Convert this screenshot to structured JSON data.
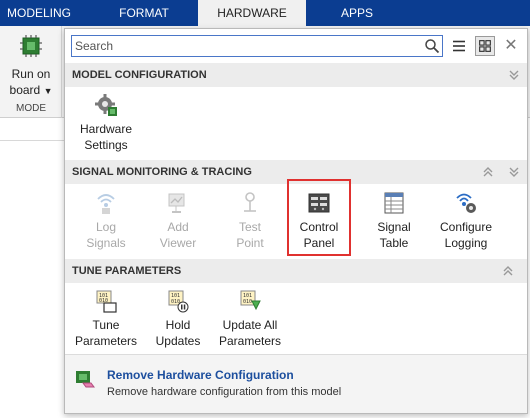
{
  "tabs": [
    {
      "label": "MODELING",
      "active": false
    },
    {
      "label": "FORMAT",
      "active": false
    },
    {
      "label": "HARDWARE",
      "active": true
    },
    {
      "label": "APPS",
      "active": false
    }
  ],
  "ribbon": {
    "mode_button": {
      "line1": "Run on",
      "line2": "board",
      "icon": "chip-icon"
    },
    "mode_caption": "MODE"
  },
  "search": {
    "placeholder": "Search",
    "value": ""
  },
  "sections": {
    "model_configuration": {
      "title": "MODEL CONFIGURATION",
      "items": [
        {
          "line1": "Hardware",
          "line2": "Settings",
          "icon": "hardware-settings-gear-icon",
          "enabled": true
        }
      ]
    },
    "signal_monitoring": {
      "title": "SIGNAL MONITORING & TRACING",
      "items": [
        {
          "line1": "Log",
          "line2": "Signals",
          "icon": "log-signals-icon",
          "enabled": false
        },
        {
          "line1": "Add",
          "line2": "Viewer",
          "icon": "add-viewer-icon",
          "enabled": false
        },
        {
          "line1": "Test",
          "line2": "Point",
          "icon": "test-point-icon",
          "enabled": false
        },
        {
          "line1": "Control",
          "line2": "Panel",
          "icon": "control-panel-icon",
          "enabled": true,
          "highlighted": true
        },
        {
          "line1": "Signal",
          "line2": "Table",
          "icon": "signal-table-icon",
          "enabled": true
        },
        {
          "line1": "Configure",
          "line2": "Logging",
          "icon": "configure-logging-icon",
          "enabled": true
        }
      ]
    },
    "tune_parameters": {
      "title": "TUNE PARAMETERS",
      "items": [
        {
          "line1": "Tune",
          "line2": "Parameters",
          "icon": "tune-parameters-icon",
          "enabled": true
        },
        {
          "line1": "Hold",
          "line2": "Updates",
          "icon": "hold-updates-icon",
          "enabled": true
        },
        {
          "line1": "Update All",
          "line2": "Parameters",
          "icon": "update-all-parameters-icon",
          "enabled": true
        }
      ]
    }
  },
  "footer": {
    "title": "Remove Hardware Configuration",
    "description": "Remove hardware configuration from this model",
    "icon": "remove-hardware-eraser-icon"
  },
  "colors": {
    "tabbar": "#0b3d91",
    "highlight": "#e0312f",
    "link": "#1d4f9e",
    "disabled_text": "#a8a8a8"
  }
}
